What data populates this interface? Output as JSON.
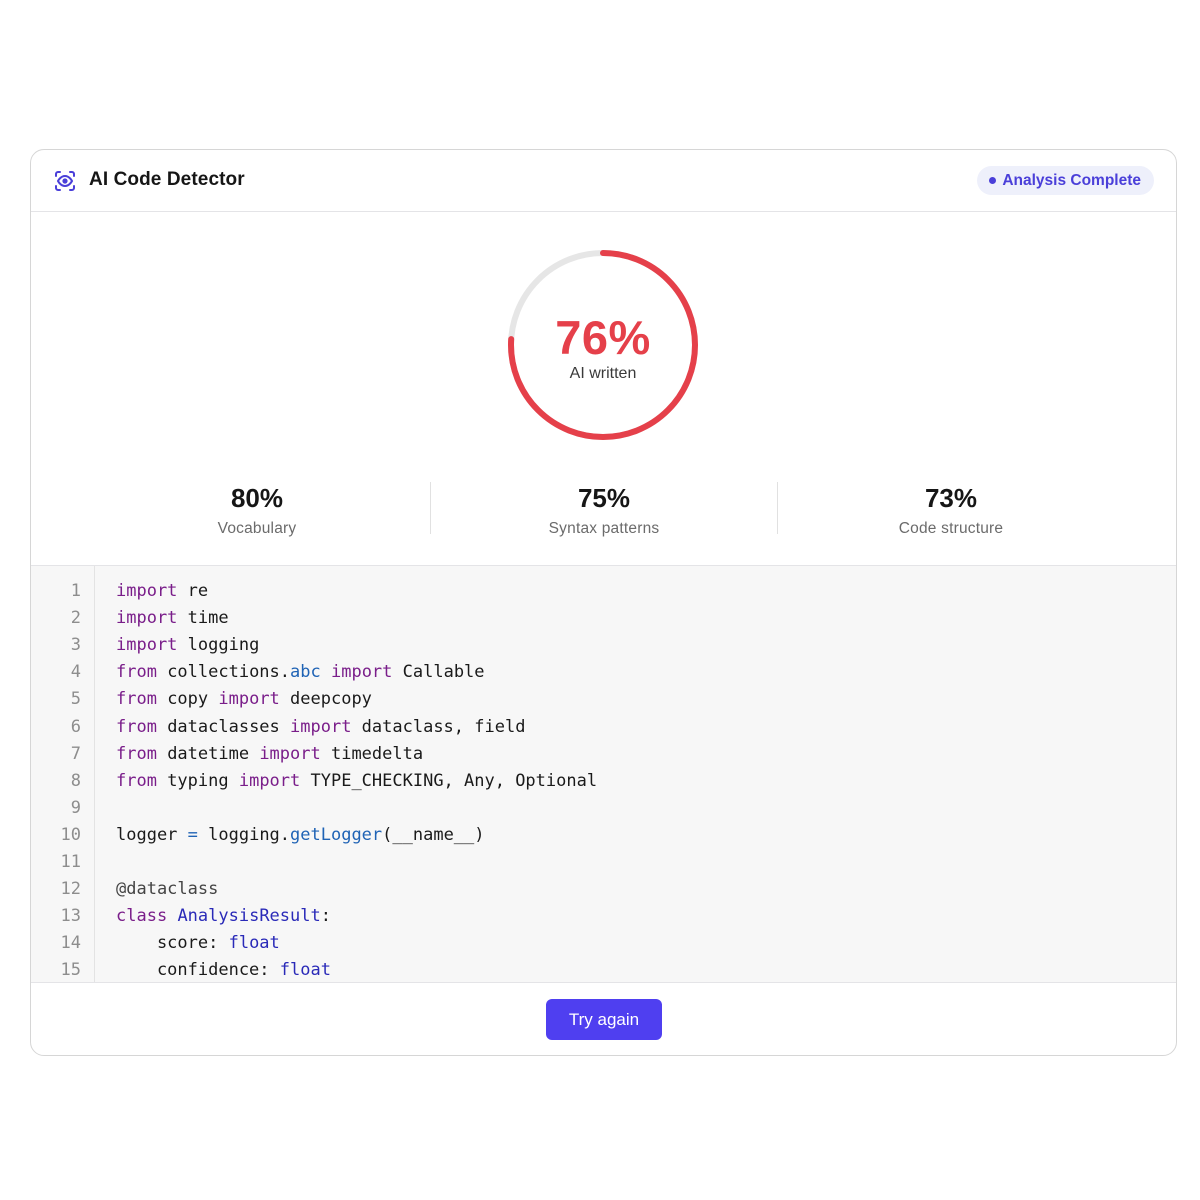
{
  "header": {
    "title": "AI Code Detector",
    "status_badge": "Analysis Complete",
    "logo_icon": "scan-eye-icon",
    "accent_color": "#4a3fd9"
  },
  "score": {
    "percent": 76,
    "value": "76%",
    "label": "AI written",
    "color": "#e5404a",
    "track_color": "#e6e6e6"
  },
  "metrics": [
    {
      "value": "80%",
      "label": "Vocabulary"
    },
    {
      "value": "75%",
      "label": "Syntax patterns"
    },
    {
      "value": "73%",
      "label": "Code structure"
    }
  ],
  "code": {
    "lines": [
      {
        "n": "1",
        "tokens": [
          [
            "kw",
            "import"
          ],
          [
            "t",
            " re"
          ]
        ]
      },
      {
        "n": "2",
        "tokens": [
          [
            "kw",
            "import"
          ],
          [
            "t",
            " time"
          ]
        ]
      },
      {
        "n": "3",
        "tokens": [
          [
            "kw",
            "import"
          ],
          [
            "t",
            " logging"
          ]
        ]
      },
      {
        "n": "4",
        "tokens": [
          [
            "kw",
            "from"
          ],
          [
            "t",
            " collections."
          ],
          [
            "fn",
            "abc"
          ],
          [
            "t",
            " "
          ],
          [
            "kw",
            "import"
          ],
          [
            "t",
            " Callable"
          ]
        ]
      },
      {
        "n": "5",
        "tokens": [
          [
            "kw",
            "from"
          ],
          [
            "t",
            " copy "
          ],
          [
            "kw",
            "import"
          ],
          [
            "t",
            " deepcopy"
          ]
        ]
      },
      {
        "n": "6",
        "tokens": [
          [
            "kw",
            "from"
          ],
          [
            "t",
            " dataclasses "
          ],
          [
            "kw",
            "import"
          ],
          [
            "t",
            " dataclass, field"
          ]
        ]
      },
      {
        "n": "7",
        "tokens": [
          [
            "kw",
            "from"
          ],
          [
            "t",
            " datetime "
          ],
          [
            "kw",
            "import"
          ],
          [
            "t",
            " timedelta"
          ]
        ]
      },
      {
        "n": "8",
        "tokens": [
          [
            "kw",
            "from"
          ],
          [
            "t",
            " typing "
          ],
          [
            "kw",
            "import"
          ],
          [
            "t",
            " TYPE_CHECKING, Any, Optional"
          ]
        ]
      },
      {
        "n": "9",
        "tokens": []
      },
      {
        "n": "10",
        "tokens": [
          [
            "t",
            "logger "
          ],
          [
            "op",
            "="
          ],
          [
            "t",
            " logging."
          ],
          [
            "fn",
            "getLogger"
          ],
          [
            "t",
            "(__name__)"
          ]
        ]
      },
      {
        "n": "11",
        "tokens": []
      },
      {
        "n": "12",
        "tokens": [
          [
            "dec",
            "@dataclass"
          ]
        ]
      },
      {
        "n": "13",
        "tokens": [
          [
            "kw",
            "class"
          ],
          [
            "t",
            " "
          ],
          [
            "cls",
            "AnalysisResult"
          ],
          [
            "t",
            ":"
          ]
        ]
      },
      {
        "n": "14",
        "tokens": [
          [
            "t",
            "    score: "
          ],
          [
            "ty",
            "float"
          ]
        ]
      },
      {
        "n": "15",
        "tokens": [
          [
            "t",
            "    confidence: "
          ],
          [
            "ty",
            "float"
          ]
        ]
      }
    ]
  },
  "actions": {
    "try_again_label": "Try again"
  }
}
